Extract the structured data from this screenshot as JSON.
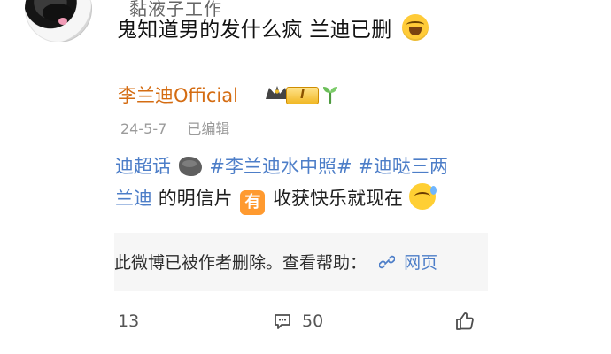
{
  "comment": {
    "username_cut": "黏液子工作",
    "text": "鬼知道男的发什么疯 兰迪已删",
    "emoji": "laughing-with-tears-icon"
  },
  "repost": {
    "account_name": "李兰迪Official",
    "level_badge": "I",
    "crown_icon": "crown-icon",
    "sprout_icon": "sprout-icon",
    "date": "24-5-7",
    "edited_label": "已编辑",
    "body": {
      "line1_part1": "迪超话",
      "line1_part2": "#李兰迪水中照#",
      "line1_part3": "#迪哒三两",
      "line2_part1": "兰迪",
      "line2_part2": "的明信片",
      "line2_part3": "有",
      "line2_part4": "收获快乐就现在"
    },
    "deleted_notice": {
      "text": "此微博已被作者删除。查看帮助：",
      "link_text": "网页"
    }
  },
  "footer": {
    "repost_count": "13",
    "comment_count": "50"
  },
  "colors": {
    "account_name": "#d46c12",
    "topic_link": "#4d7ec8",
    "deleted_box_bg": "#f6f6f6"
  }
}
